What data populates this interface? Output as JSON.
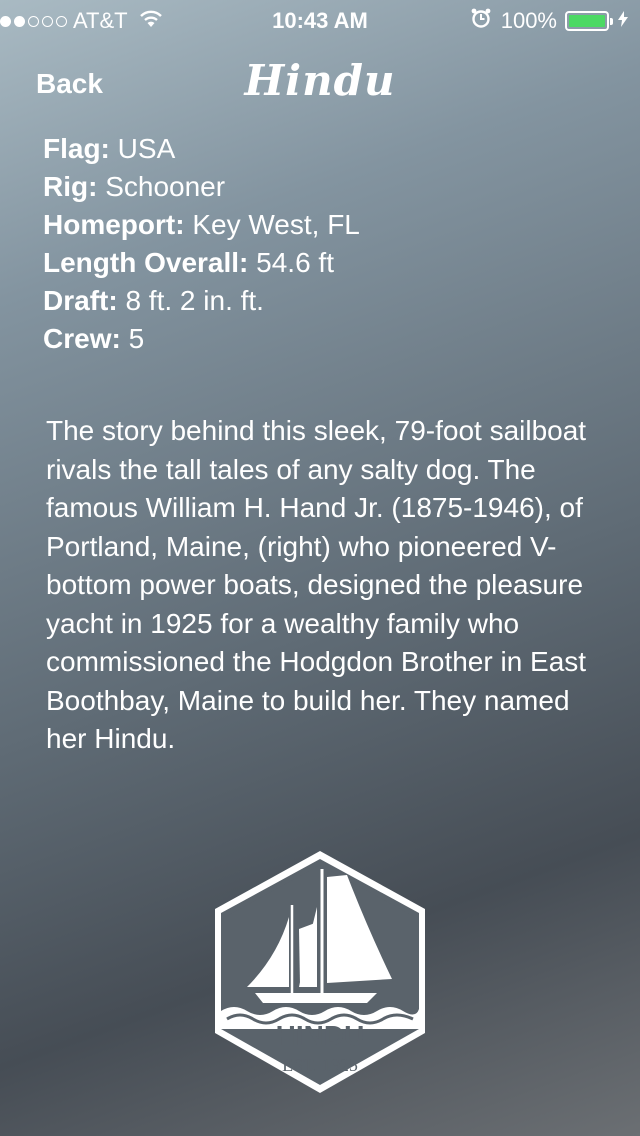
{
  "status": {
    "carrier": "AT&T",
    "time": "10:43 AM",
    "battery": "100%",
    "battery_level": 1.0,
    "signal_bars_filled": 2,
    "signal_bars_total": 5
  },
  "nav": {
    "back_label": "Back",
    "title": "Hindu"
  },
  "specs": [
    {
      "label": "Flag:",
      "value": "USA"
    },
    {
      "label": "Rig:",
      "value": "Schooner"
    },
    {
      "label": "Homeport:",
      "value": "Key West, FL"
    },
    {
      "label": "Length Overall:",
      "value": "54.6 ft"
    },
    {
      "label": "Draft:",
      "value": "8 ft. 2 in. ft."
    },
    {
      "label": "Crew:",
      "value": "5"
    }
  ],
  "story": "The story behind this sleek, 79-foot sailboat rivals the tall tales of any salty dog. The famous William H. Hand Jr. (1875-1946), of Portland, Maine, (right) who pioneered V-bottom power boats, designed the pleasure yacht in 1925 for a wealthy family who commissioned the Hodgdon Brother in East Boothbay, Maine to build her. They named her Hindu.",
  "logo": {
    "name": "HINDU",
    "est": "EST. 1925"
  },
  "colors": {
    "battery": "#4cd964"
  }
}
